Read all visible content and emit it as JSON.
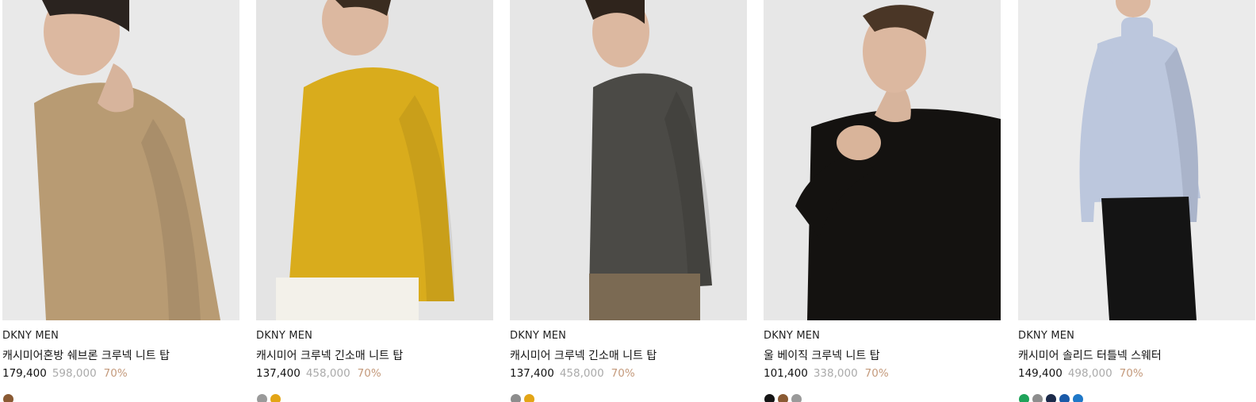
{
  "products": [
    {
      "brand": "DKNY MEN",
      "name": "캐시미어혼방 쉐브론 크루넥 니트 탑",
      "sale_price": "179,400",
      "original_price": "598,000",
      "discount": "70%",
      "product_color": "#b89b73",
      "swatches": [
        "#8a5a33"
      ]
    },
    {
      "brand": "DKNY MEN",
      "name": "캐시미어 크루넥 긴소매 니트 탑",
      "sale_price": "137,400",
      "original_price": "458,000",
      "discount": "70%",
      "product_color": "#d9ac1c",
      "swatches": [
        "#9a9a9a",
        "#e3a516"
      ]
    },
    {
      "brand": "DKNY MEN",
      "name": "캐시미어 크루넥 긴소매 니트 탑",
      "sale_price": "137,400",
      "original_price": "458,000",
      "discount": "70%",
      "product_color": "#4b4a46",
      "swatches": [
        "#8d8d8d",
        "#e3a516"
      ]
    },
    {
      "brand": "DKNY MEN",
      "name": "울 베이직 크루넥 니트 탑",
      "sale_price": "101,400",
      "original_price": "338,000",
      "discount": "70%",
      "product_color": "#141210",
      "swatches": [
        "#151515",
        "#8a5a33",
        "#9a9a9a"
      ]
    },
    {
      "brand": "DKNY MEN",
      "name": "캐시미어 솔리드 터틀넥 스웨터",
      "sale_price": "149,400",
      "original_price": "498,000",
      "discount": "70%",
      "product_color": "#bcc7dd",
      "swatches": [
        "#1fa35a",
        "#8d8d8d",
        "#1c2a4a",
        "#1a5aa8",
        "#1f78c8"
      ]
    }
  ]
}
